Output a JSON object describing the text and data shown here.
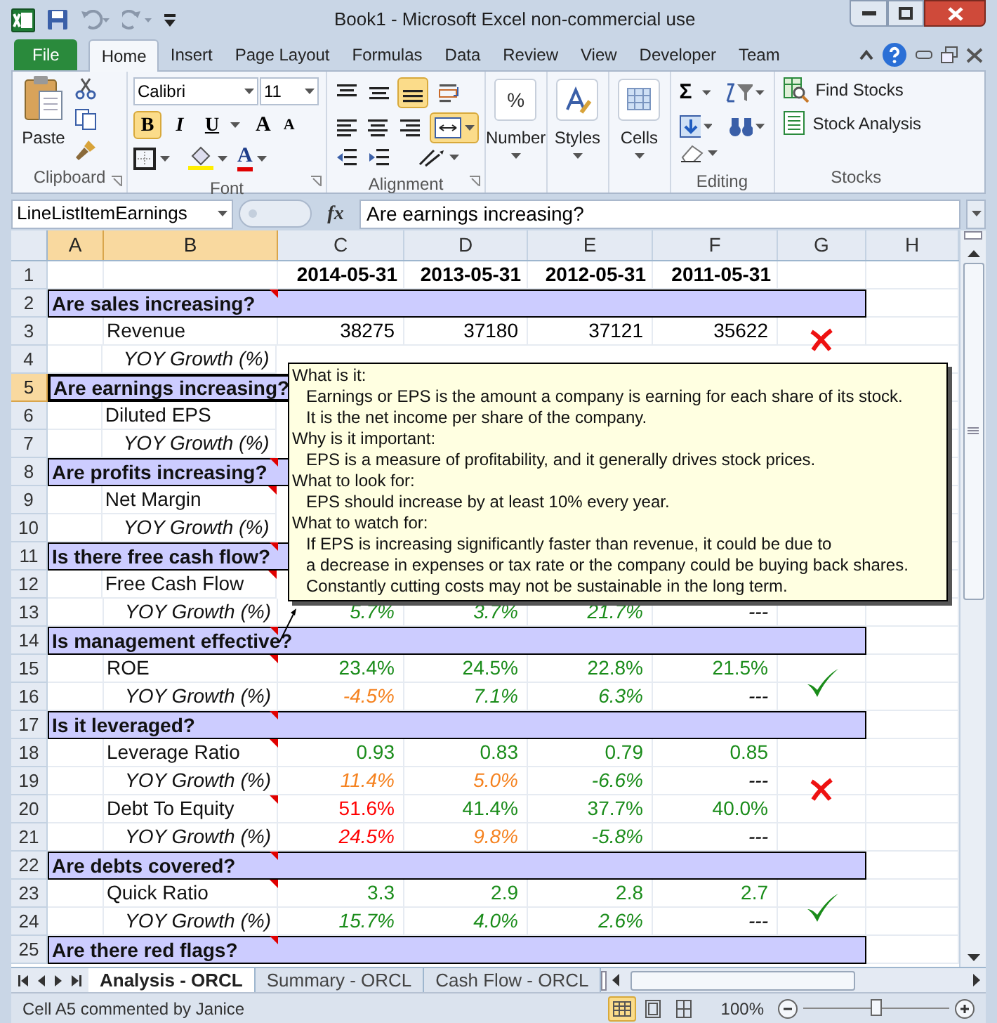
{
  "window": {
    "title": "Book1  -  Microsoft Excel non-commercial use"
  },
  "ribbon": {
    "tabs": [
      {
        "label": "File",
        "kind": "file",
        "selected": false
      },
      {
        "label": "Home",
        "kind": "tab",
        "selected": true
      },
      {
        "label": "Insert",
        "kind": "tab",
        "selected": false
      },
      {
        "label": "Page Layout",
        "kind": "tab",
        "selected": false
      },
      {
        "label": "Formulas",
        "kind": "tab",
        "selected": false
      },
      {
        "label": "Data",
        "kind": "tab",
        "selected": false
      },
      {
        "label": "Review",
        "kind": "tab",
        "selected": false
      },
      {
        "label": "View",
        "kind": "tab",
        "selected": false
      },
      {
        "label": "Developer",
        "kind": "tab",
        "selected": false
      },
      {
        "label": "Team",
        "kind": "tab",
        "selected": false
      }
    ],
    "paste": "Paste",
    "font_name": "Calibri",
    "font_size": "11",
    "bold": {
      "label": "B",
      "on": true
    },
    "italic": {
      "label": "I",
      "on": false
    },
    "underline": {
      "label": "U",
      "on": false
    },
    "grow_font": "A",
    "shrink_font": "A",
    "font_color": "A",
    "align_bottom_on": true,
    "merge_on": true,
    "number": {
      "symbol": "%",
      "label": "Number"
    },
    "styles": "Styles",
    "cells": "Cells",
    "autosum": "Σ",
    "find_stocks": "Find Stocks",
    "stock_analysis": "Stock Analysis",
    "groups": [
      "Clipboard",
      "Font",
      "Alignment",
      "Editing",
      "Stocks"
    ]
  },
  "formula_bar": {
    "name_box": "LineListItemEarnings",
    "insert_function": "fx",
    "formula": "Are earnings increasing?"
  },
  "columns": [
    {
      "label": "A",
      "selected": true
    },
    {
      "label": "B",
      "selected": true
    },
    {
      "label": "C",
      "selected": false
    },
    {
      "label": "D",
      "selected": false
    },
    {
      "label": "E",
      "selected": false
    },
    {
      "label": "F",
      "selected": false
    },
    {
      "label": "G",
      "selected": false
    },
    {
      "label": "H",
      "selected": false
    }
  ],
  "rows": [
    {
      "number": "1",
      "kind": "dates",
      "selected": false,
      "cells": [
        {
          "text": "2014-05-31"
        },
        {
          "text": "2013-05-31"
        },
        {
          "text": "2012-05-31"
        },
        {
          "text": "2011-05-31"
        }
      ]
    },
    {
      "number": "2",
      "kind": "section",
      "selected": false,
      "label": "Are sales increasing?",
      "comment": true
    },
    {
      "number": "3",
      "kind": "metric",
      "selected": false,
      "label": "Revenue",
      "cells": [
        {
          "text": "38275",
          "color": "#000000"
        },
        {
          "text": "37180",
          "color": "#000000"
        },
        {
          "text": "37121",
          "color": "#000000"
        },
        {
          "text": "35622",
          "color": "#000000"
        }
      ],
      "passed": false
    },
    {
      "number": "4",
      "kind": "growth",
      "selected": false,
      "label": "YOY Growth (%)"
    },
    {
      "number": "5",
      "kind": "section",
      "selected": true,
      "label": "Are earnings increasing?"
    },
    {
      "number": "6",
      "kind": "metric",
      "selected": false,
      "label": "Diluted EPS"
    },
    {
      "number": "7",
      "kind": "growth",
      "selected": false,
      "label": "YOY Growth (%)"
    },
    {
      "number": "8",
      "kind": "section",
      "selected": false,
      "label": "Are profits increasing?",
      "comment": true
    },
    {
      "number": "9",
      "kind": "metric",
      "selected": false,
      "label": "Net Margin",
      "comment": true
    },
    {
      "number": "10",
      "kind": "growth",
      "selected": false,
      "label": "YOY Growth (%)"
    },
    {
      "number": "11",
      "kind": "section",
      "selected": false,
      "label": "Is there free cash flow?",
      "comment": true
    },
    {
      "number": "12",
      "kind": "metric",
      "selected": false,
      "label": "Free Cash Flow",
      "comment": true
    },
    {
      "number": "13",
      "kind": "growth",
      "selected": false,
      "label": "YOY Growth (%)",
      "cells": [
        {
          "text": "5.7%",
          "color": "#1a8c1a"
        },
        {
          "text": "3.7%",
          "color": "#1a8c1a"
        },
        {
          "text": "21.7%",
          "color": "#1a8c1a"
        },
        {
          "text": "---",
          "color": "#000000"
        }
      ]
    },
    {
      "number": "14",
      "kind": "section",
      "selected": false,
      "label": "Is management effective?",
      "comment": true
    },
    {
      "number": "15",
      "kind": "metric",
      "selected": false,
      "label": "ROE",
      "comment": true,
      "cells": [
        {
          "text": "23.4%",
          "color": "#1a8c1a"
        },
        {
          "text": "24.5%",
          "color": "#1a8c1a"
        },
        {
          "text": "22.8%",
          "color": "#1a8c1a"
        },
        {
          "text": "21.5%",
          "color": "#1a8c1a"
        }
      ],
      "passed": true
    },
    {
      "number": "16",
      "kind": "growth",
      "selected": false,
      "label": "YOY Growth (%)",
      "cells": [
        {
          "text": "-4.5%",
          "color": "#f5821f"
        },
        {
          "text": "7.1%",
          "color": "#1a8c1a"
        },
        {
          "text": "6.3%",
          "color": "#1a8c1a"
        },
        {
          "text": "---",
          "color": "#000000"
        }
      ]
    },
    {
      "number": "17",
      "kind": "section",
      "selected": false,
      "label": "Is it leveraged?",
      "comment": true
    },
    {
      "number": "18",
      "kind": "metric",
      "selected": false,
      "label": "Leverage Ratio",
      "comment": true,
      "cells": [
        {
          "text": "0.93",
          "color": "#1a8c1a"
        },
        {
          "text": "0.83",
          "color": "#1a8c1a"
        },
        {
          "text": "0.79",
          "color": "#1a8c1a"
        },
        {
          "text": "0.85",
          "color": "#1a8c1a"
        }
      ]
    },
    {
      "number": "19",
      "kind": "growth",
      "selected": false,
      "label": "YOY Growth (%)",
      "cells": [
        {
          "text": "11.4%",
          "color": "#f5821f"
        },
        {
          "text": "5.0%",
          "color": "#f5821f"
        },
        {
          "text": "-6.6%",
          "color": "#1a8c1a"
        },
        {
          "text": "---",
          "color": "#000000"
        }
      ],
      "passed": false
    },
    {
      "number": "20",
      "kind": "metric",
      "selected": false,
      "label": "Debt To Equity",
      "comment": true,
      "cells": [
        {
          "text": "51.6%",
          "color": "#ff0000"
        },
        {
          "text": "41.4%",
          "color": "#1a8c1a"
        },
        {
          "text": "37.7%",
          "color": "#1a8c1a"
        },
        {
          "text": "40.0%",
          "color": "#1a8c1a"
        }
      ]
    },
    {
      "number": "21",
      "kind": "growth",
      "selected": false,
      "label": "YOY Growth (%)",
      "cells": [
        {
          "text": "24.5%",
          "color": "#ff0000"
        },
        {
          "text": "9.8%",
          "color": "#f5821f"
        },
        {
          "text": "-5.8%",
          "color": "#1a8c1a"
        },
        {
          "text": "---",
          "color": "#000000"
        }
      ]
    },
    {
      "number": "22",
      "kind": "section",
      "selected": false,
      "label": "Are debts covered?",
      "comment": true
    },
    {
      "number": "23",
      "kind": "metric",
      "selected": false,
      "label": "Quick Ratio",
      "comment": true,
      "cells": [
        {
          "text": "3.3",
          "color": "#1a8c1a"
        },
        {
          "text": "2.9",
          "color": "#1a8c1a"
        },
        {
          "text": "2.8",
          "color": "#1a8c1a"
        },
        {
          "text": "2.7",
          "color": "#1a8c1a"
        }
      ],
      "passed": true
    },
    {
      "number": "24",
      "kind": "growth",
      "selected": false,
      "label": "YOY Growth (%)",
      "cells": [
        {
          "text": "15.7%",
          "color": "#1a8c1a"
        },
        {
          "text": "4.0%",
          "color": "#1a8c1a"
        },
        {
          "text": "2.6%",
          "color": "#1a8c1a"
        },
        {
          "text": "---",
          "color": "#000000"
        }
      ]
    },
    {
      "number": "25",
      "kind": "section",
      "selected": false,
      "label": "Are there red flags?",
      "comment": true
    }
  ],
  "comment": {
    "lines": [
      {
        "kind": "heading",
        "text": "What is it:"
      },
      {
        "kind": "body",
        "text": "Earnings or EPS is the amount a company is earning for each share of its stock."
      },
      {
        "kind": "body",
        "text": "It is the net income per share of the company."
      },
      {
        "kind": "heading",
        "text": "Why is it important:"
      },
      {
        "kind": "body",
        "text": "EPS is a measure of profitability, and it generally drives stock prices."
      },
      {
        "kind": "heading",
        "text": "What to look for:"
      },
      {
        "kind": "body",
        "text": "EPS should increase by at least 10% every year."
      },
      {
        "kind": "heading",
        "text": "What to watch for:"
      },
      {
        "kind": "body",
        "text": "If EPS is increasing significantly faster than revenue, it could be due to"
      },
      {
        "kind": "body",
        "text": "a decrease in expenses or tax rate or the company could be buying back shares."
      },
      {
        "kind": "body",
        "text": "Constantly cutting costs may not be sustainable in the long term."
      }
    ]
  },
  "sheet_tabs": [
    {
      "label": "Analysis - ORCL",
      "selected": true
    },
    {
      "label": "Summary - ORCL",
      "selected": false
    },
    {
      "label": "Cash Flow - ORCL",
      "selected": false
    }
  ],
  "status_bar": {
    "text": "Cell A5 commented by Janice",
    "views": [
      {
        "kind": "normal",
        "selected": true
      },
      {
        "kind": "layout",
        "selected": false
      },
      {
        "kind": "break",
        "selected": false
      }
    ],
    "zoom": "100%",
    "zoom_slider": {
      "level": 0.5
    }
  }
}
